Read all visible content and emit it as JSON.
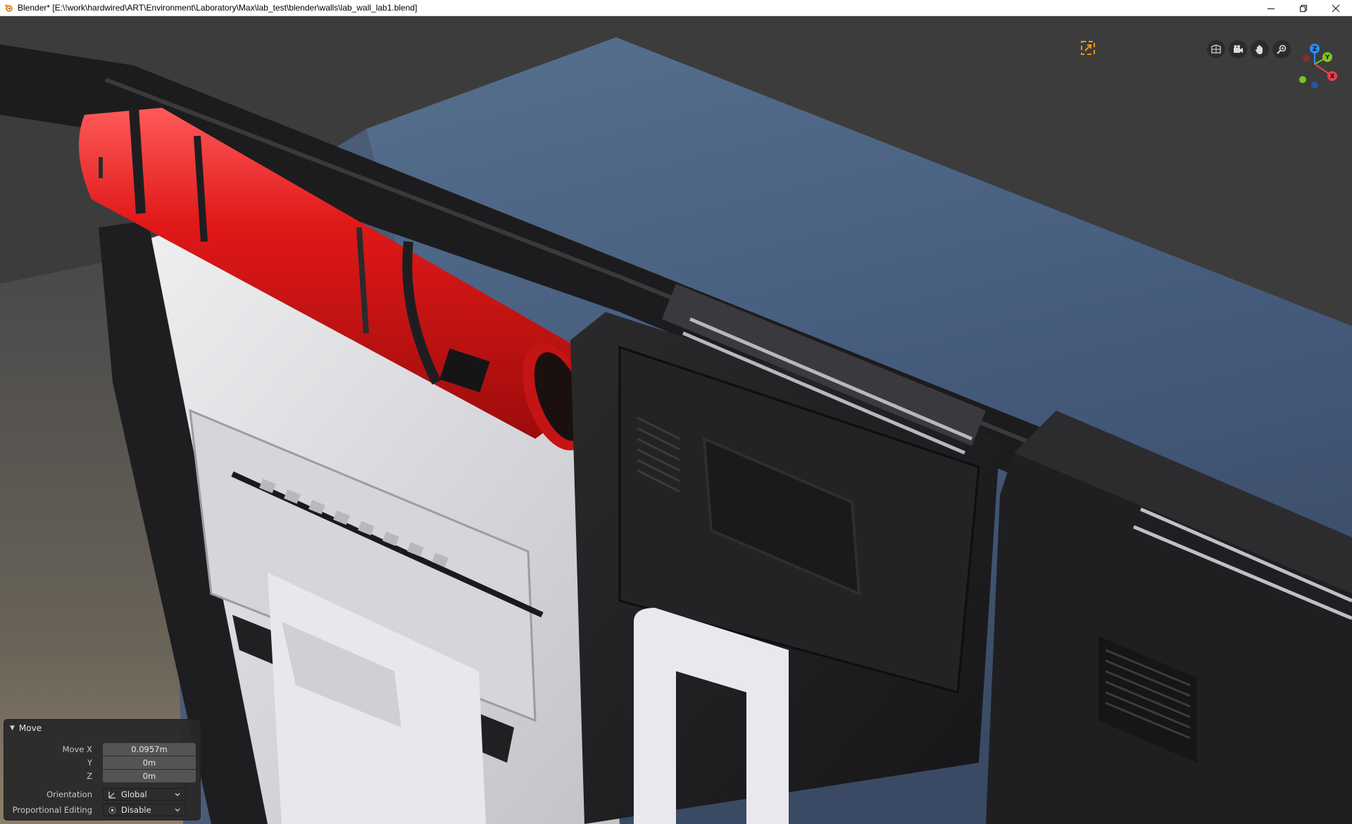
{
  "window": {
    "title": "Blender* [E:\\!work\\hardwired\\ART\\Environment\\Laboratory\\Max\\lab_test\\blender\\walls\\lab_wall_lab1.blend]",
    "buttons": [
      "minimize-icon",
      "restore-icon",
      "close-icon"
    ]
  },
  "viewport": {
    "background": "#3b3b3b",
    "floor_color": "#4a5f78",
    "tools": [
      "toggle-xray-icon",
      "camera-view-icon",
      "pan-hand-icon",
      "zoom-icon"
    ],
    "gizmo": {
      "axes": [
        "X",
        "Y",
        "Z"
      ],
      "colors": {
        "x": "#e8414c",
        "y": "#7fc320",
        "z": "#2b8ef0"
      }
    },
    "camera_frame_color": "#f09318"
  },
  "operator_panel": {
    "title": "Move",
    "move_x_label": "Move X",
    "move_x_value": "0.0957m",
    "y_label": "Y",
    "y_value": "0m",
    "z_label": "Z",
    "z_value": "0m",
    "orientation_label": "Orientation",
    "orientation_value": "Global",
    "proportional_label": "Proportional Editing",
    "proportional_value": "Disable"
  }
}
